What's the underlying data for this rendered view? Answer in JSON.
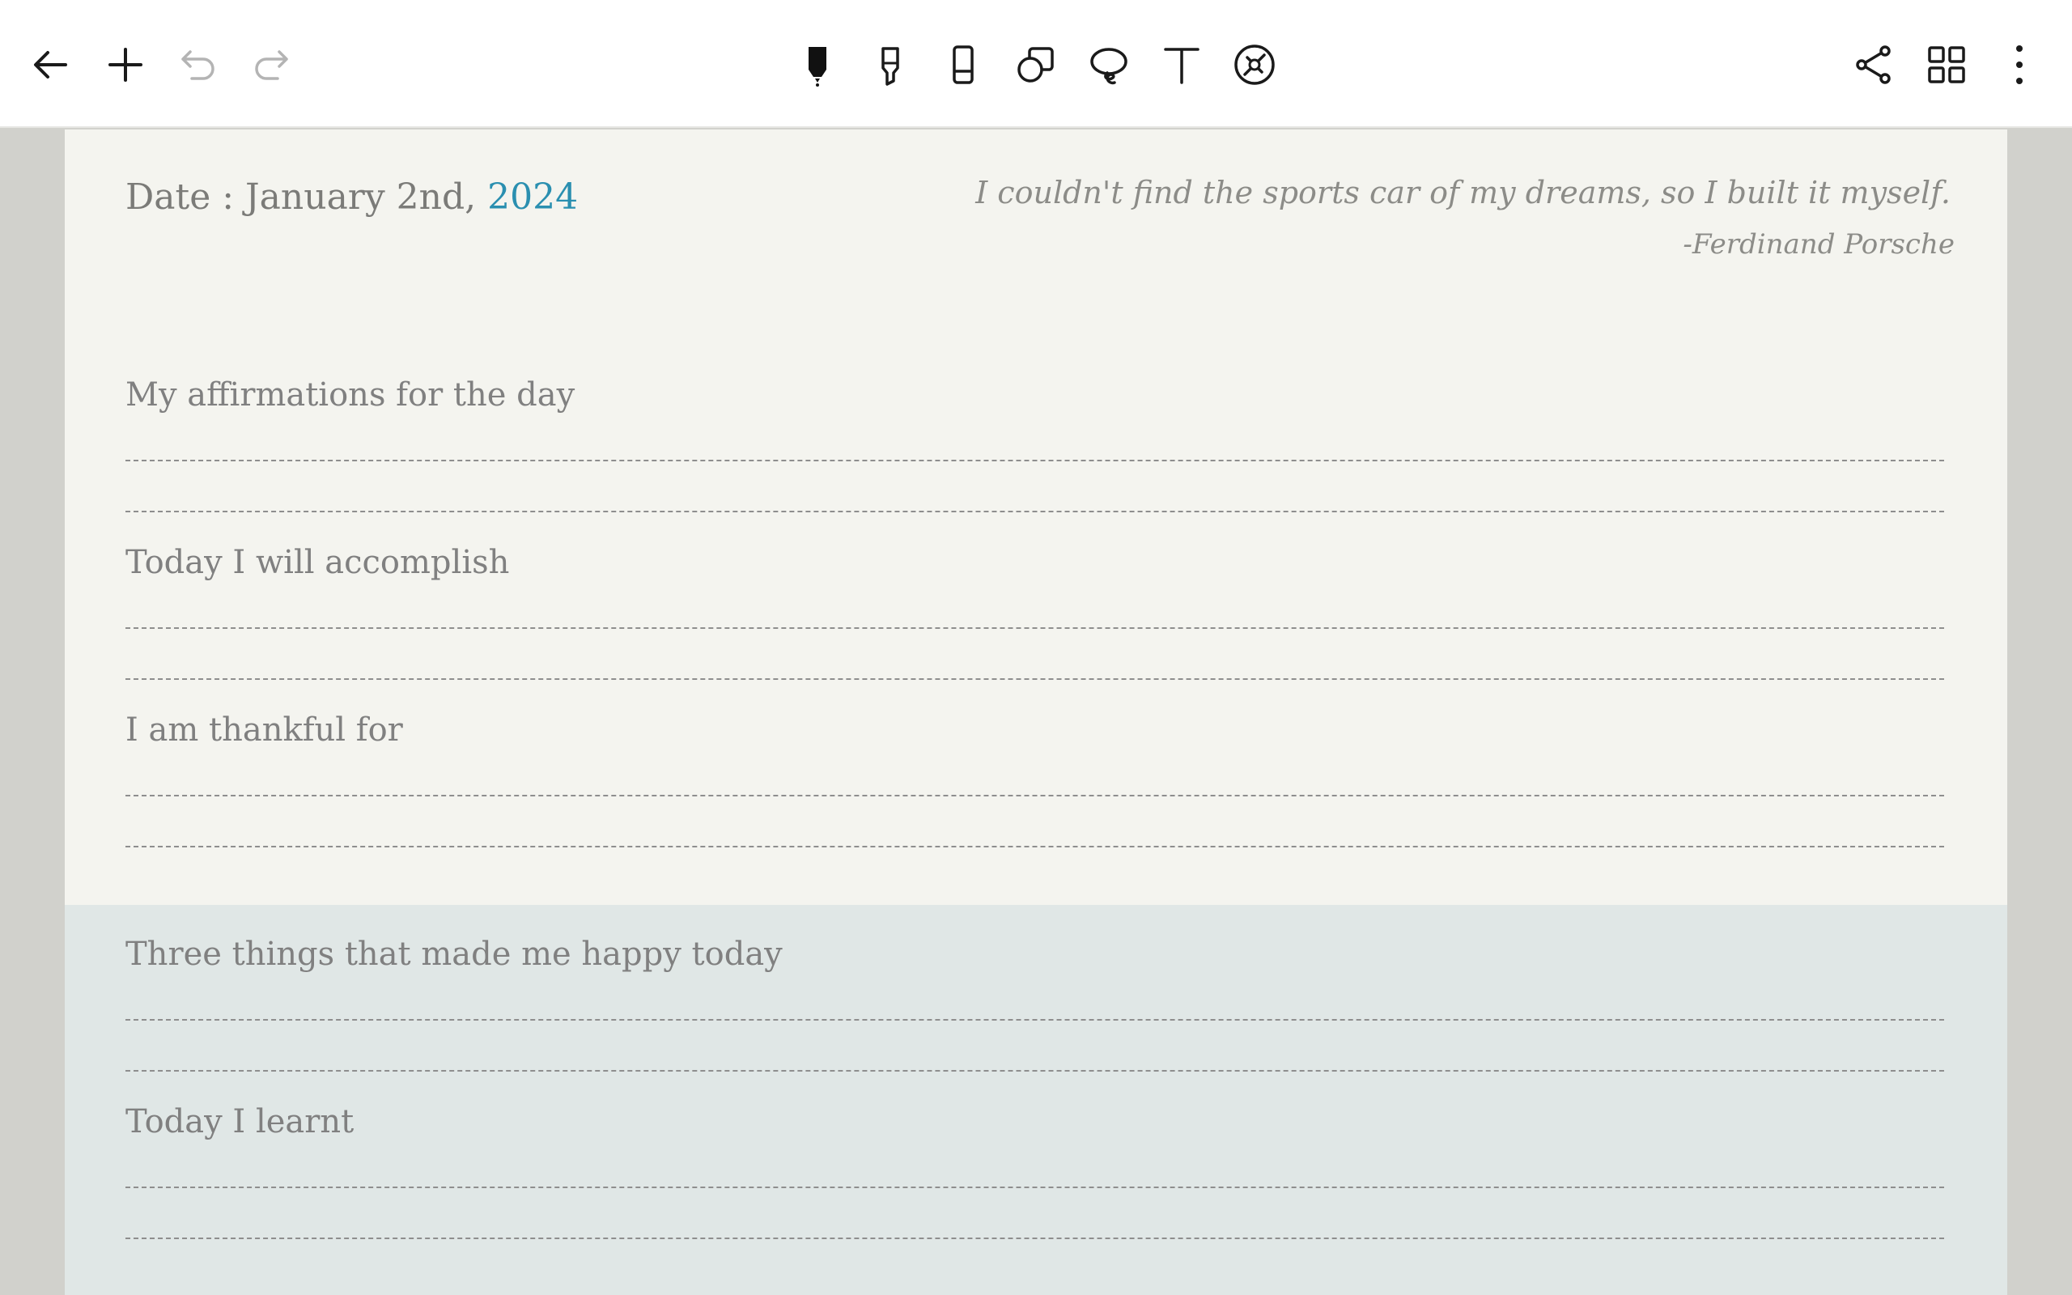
{
  "toolbar": {
    "left": [
      {
        "icon": "back-arrow-icon"
      },
      {
        "icon": "add-icon"
      },
      {
        "icon": "undo-icon"
      },
      {
        "icon": "redo-icon"
      }
    ],
    "tools": [
      {
        "icon": "pen-icon",
        "active": true
      },
      {
        "icon": "highlighter-icon"
      },
      {
        "icon": "eraser-icon"
      },
      {
        "icon": "shapes-icon"
      },
      {
        "icon": "lasso-icon"
      },
      {
        "icon": "text-icon"
      },
      {
        "icon": "laser-pointer-icon"
      }
    ],
    "right": [
      {
        "icon": "share-icon"
      },
      {
        "icon": "grid-view-icon"
      },
      {
        "icon": "more-vertical-icon"
      }
    ]
  },
  "page": {
    "date_prefix": "Date : January 2nd, ",
    "date_year": "2024",
    "quote": "I couldn't find the sports car of my dreams, so I built it myself.",
    "quote_author": "-Ferdinand Porsche",
    "sections": [
      "My affirmations for the day",
      "Today I will accomplish",
      "I am thankful for",
      "Three things that made me happy today",
      "Today I learnt"
    ]
  },
  "colors": {
    "page_background": "#f4f4ef",
    "lower_band": "#e0e7e6",
    "accent_year": "#2a8fb0",
    "canvas_background": "#d1d1cc"
  }
}
